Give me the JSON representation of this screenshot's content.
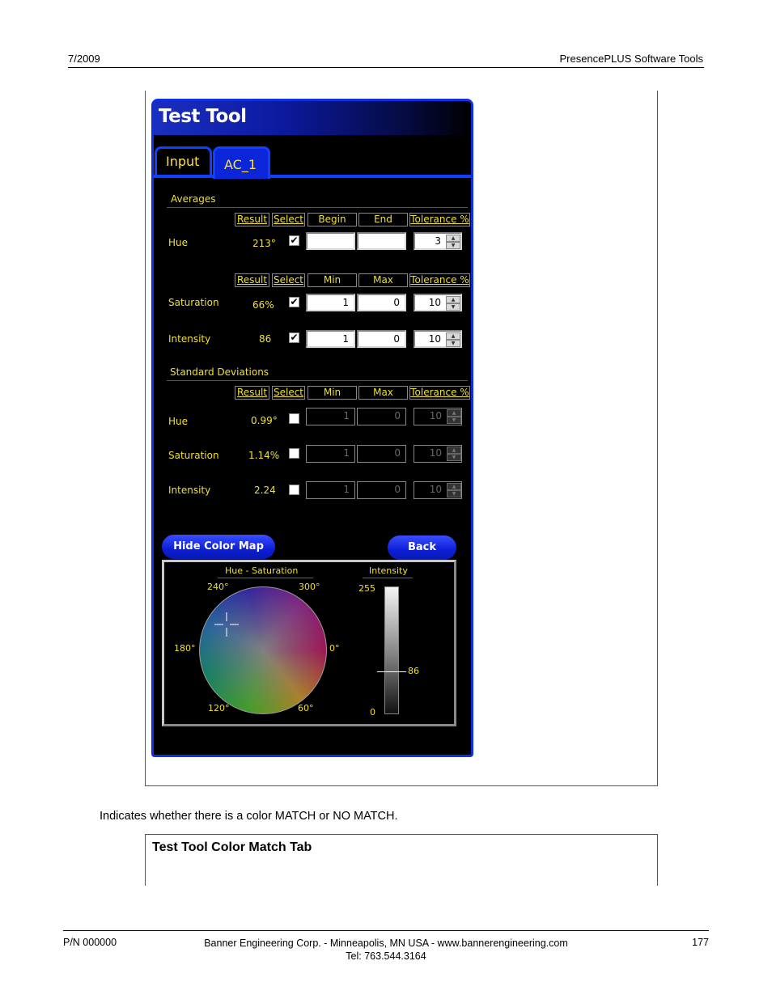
{
  "header": {
    "date": "7/2009",
    "doc_title": "PresencePLUS Software Tools"
  },
  "screen": {
    "title": "Test Tool",
    "tabs": [
      "Input",
      "AC_1"
    ],
    "averages": {
      "section_label": "Averages",
      "hue_columns": [
        "Result",
        "Select",
        "Begin",
        "End",
        "Tolerance %"
      ],
      "hue": {
        "label": "Hue",
        "result": "213°",
        "checked": true,
        "begin": "",
        "end": "",
        "tolerance": "3"
      },
      "columns": [
        "Result",
        "Select",
        "Min",
        "Max",
        "Tolerance %"
      ],
      "rows": [
        {
          "label": "Saturation",
          "result": "66%",
          "checked": true,
          "min": "1",
          "max": "0",
          "tolerance": "10"
        },
        {
          "label": "Intensity",
          "result": "86",
          "checked": true,
          "min": "1",
          "max": "0",
          "tolerance": "10"
        }
      ]
    },
    "std_dev": {
      "section_label": "Standard Deviations",
      "columns": [
        "Result",
        "Select",
        "Min",
        "Max",
        "Tolerance %"
      ],
      "rows": [
        {
          "label": "Hue",
          "result": "0.99°",
          "checked": false,
          "min": "1",
          "max": "0",
          "tolerance": "10"
        },
        {
          "label": "Saturation",
          "result": "1.14%",
          "checked": false,
          "min": "1",
          "max": "0",
          "tolerance": "10"
        },
        {
          "label": "Intensity",
          "result": "2.24",
          "checked": false,
          "min": "1",
          "max": "0",
          "tolerance": "10"
        }
      ]
    },
    "buttons": {
      "hide_color_map": "Hide Color Map",
      "back": "Back"
    },
    "color_map": {
      "hs_label": "Hue - Saturation",
      "intensity_label": "Intensity",
      "angles": {
        "a240": "240°",
        "a300": "300°",
        "a180": "180°",
        "a0": "0°",
        "a120": "120°",
        "a60": "60°"
      },
      "intensity_max": "255",
      "intensity_min": "0",
      "intensity_value": "86"
    }
  },
  "caption": "Indicates whether there is a color MATCH or NO MATCH.",
  "next_box_title": "Test Tool Color Match Tab",
  "footer": {
    "pn": "P/N 000000",
    "company": "Banner Engineering Corp. - Minneapolis, MN USA - www.bannerengineering.com",
    "tel": "Tel: 763.544.3164",
    "page": "177"
  },
  "colors": {
    "accent_blue": "#1040ff",
    "label_yellow": "#f0e030"
  }
}
